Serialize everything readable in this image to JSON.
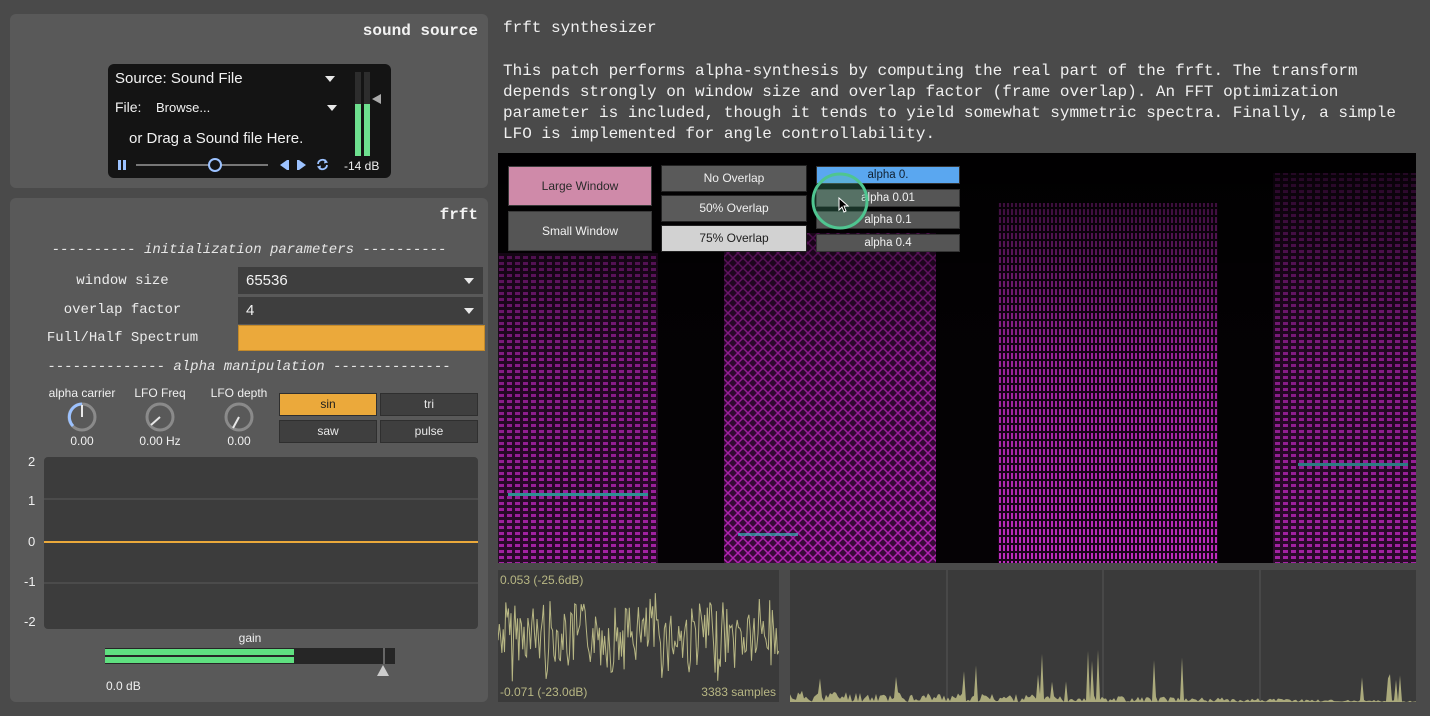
{
  "sound_source": {
    "title": "sound source",
    "source_label": "Source: Sound File",
    "file_label": "File:",
    "file_value": "Browse...",
    "drag_hint": "or Drag a Sound file Here.",
    "level_db": "-14 dB",
    "meter_level": 0.62,
    "playhead": 0.6
  },
  "frft": {
    "title": "frft",
    "init_header": "---------- initialization parameters ----------",
    "window_size_label": "window size",
    "window_size_value": "65536",
    "overlap_label": "overlap factor",
    "overlap_value": "4",
    "spectrum_label": "Full/Half Spectrum",
    "alpha_header": "-------------- alpha manipulation --------------",
    "knobs": [
      {
        "label": "alpha carrier",
        "value": "0.00"
      },
      {
        "label": "LFO Freq",
        "value": "0.00 Hz"
      },
      {
        "label": "LFO depth",
        "value": "0.00"
      }
    ],
    "wave_buttons": [
      {
        "label": "sin",
        "active": true
      },
      {
        "label": "tri",
        "active": false
      },
      {
        "label": "saw",
        "active": false
      },
      {
        "label": "pulse",
        "active": false
      }
    ],
    "scope_y_labels": [
      "2",
      "1",
      "0",
      "-1",
      "-2"
    ],
    "gain_label": "gain",
    "gain_value": "0.0 dB",
    "gain_level": 0.65
  },
  "info": {
    "title": "frft synthesizer",
    "description": "This patch performs alpha-synthesis by computing the real part of the frft. The transform depends strongly on window size and overlap factor (frame overlap). An FFT optimization parameter is included, though it tends to yield somewhat symmetric spectra. Finally, a simple LFO is implemented for angle controllability."
  },
  "spectrogram": {
    "window_buttons": [
      {
        "label": "Large Window",
        "active": true
      },
      {
        "label": "Small Window",
        "active": false
      }
    ],
    "overlap_buttons": [
      {
        "label": "No Overlap",
        "active": false
      },
      {
        "label": "50% Overlap",
        "active": false
      },
      {
        "label": "75% Overlap",
        "active": true
      }
    ],
    "alpha_buttons": [
      {
        "label": "alpha 0.",
        "active": true
      },
      {
        "label": "alpha 0.01",
        "active": false
      },
      {
        "label": "alpha 0.1",
        "active": false
      },
      {
        "label": "alpha 0.4",
        "active": false
      }
    ]
  },
  "waveform": {
    "top_label": "0.053 (-25.6dB)",
    "bottom_label": "-0.071 (-23.0dB)",
    "samples_label": "3383 samples"
  },
  "colors": {
    "accent_orange": "#eba93b",
    "pink_active": "#cf8aa9",
    "alpha_active": "#5aa7f0",
    "meter_green": "#6ee08f",
    "wave_olive": "#b8b784"
  }
}
